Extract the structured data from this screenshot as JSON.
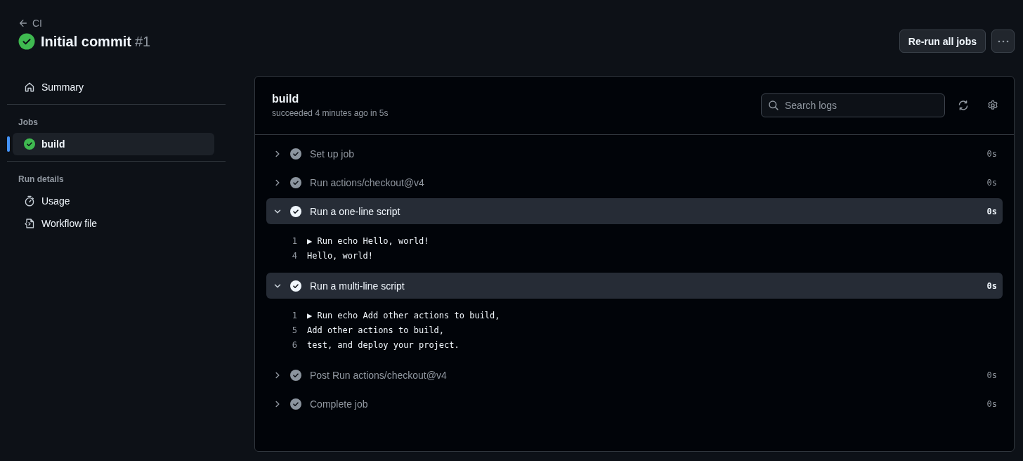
{
  "header": {
    "back_link": "CI",
    "title": "Initial commit",
    "run_number": "#1",
    "succeeded": true
  },
  "actions": {
    "rerun_button": "Re-run all jobs"
  },
  "sidebar": {
    "summary": "Summary",
    "jobs_heading": "Jobs",
    "jobs": [
      {
        "name": "build",
        "succeeded": true,
        "selected": true
      }
    ],
    "details_heading": "Run details",
    "details": [
      {
        "kind": "usage",
        "label": "Usage"
      },
      {
        "kind": "workflow",
        "label": "Workflow file"
      }
    ]
  },
  "job": {
    "title": "build",
    "subtitle": "succeeded 4 minutes ago in 5s",
    "search": {
      "placeholder": "Search logs"
    },
    "steps": [
      {
        "name": "Set up job",
        "duration": "0s",
        "expanded": false
      },
      {
        "name": "Run actions/checkout@v4",
        "duration": "0s",
        "expanded": false
      },
      {
        "name": "Run a one-line script",
        "duration": "0s",
        "expanded": true,
        "lines": [
          {
            "number": "1",
            "text": "▶ Run echo Hello, world!"
          },
          {
            "number": "4",
            "text": "Hello, world!"
          }
        ]
      },
      {
        "name": "Run a multi-line script",
        "duration": "0s",
        "expanded": true,
        "lines": [
          {
            "number": "1",
            "text": "▶ Run echo Add other actions to build,"
          },
          {
            "number": "5",
            "text": "Add other actions to build,"
          },
          {
            "number": "6",
            "text": "test, and deploy your project."
          }
        ]
      },
      {
        "name": "Post Run actions/checkout@v4",
        "duration": "0s",
        "expanded": false
      },
      {
        "name": "Complete job",
        "duration": "0s",
        "expanded": false
      }
    ]
  }
}
